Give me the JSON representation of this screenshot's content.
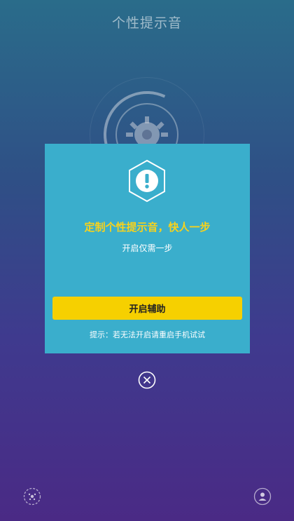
{
  "header": {
    "title": "个性提示音"
  },
  "dialog": {
    "icon": "warning-hexagon-icon",
    "heading": "定制个性提示音，快人一步",
    "subtext": "开启仅需一步",
    "button_label": "开启辅助",
    "hint": "提示：若无法开启请重启手机试试"
  },
  "controls": {
    "close_icon": "close-circle-icon",
    "left_icon": "sparkle-circle-icon",
    "right_icon": "profile-circle-icon"
  },
  "colors": {
    "dialog_bg": "#3aaecc",
    "accent_yellow": "#f7d21c",
    "button_yellow": "#f6d000"
  }
}
